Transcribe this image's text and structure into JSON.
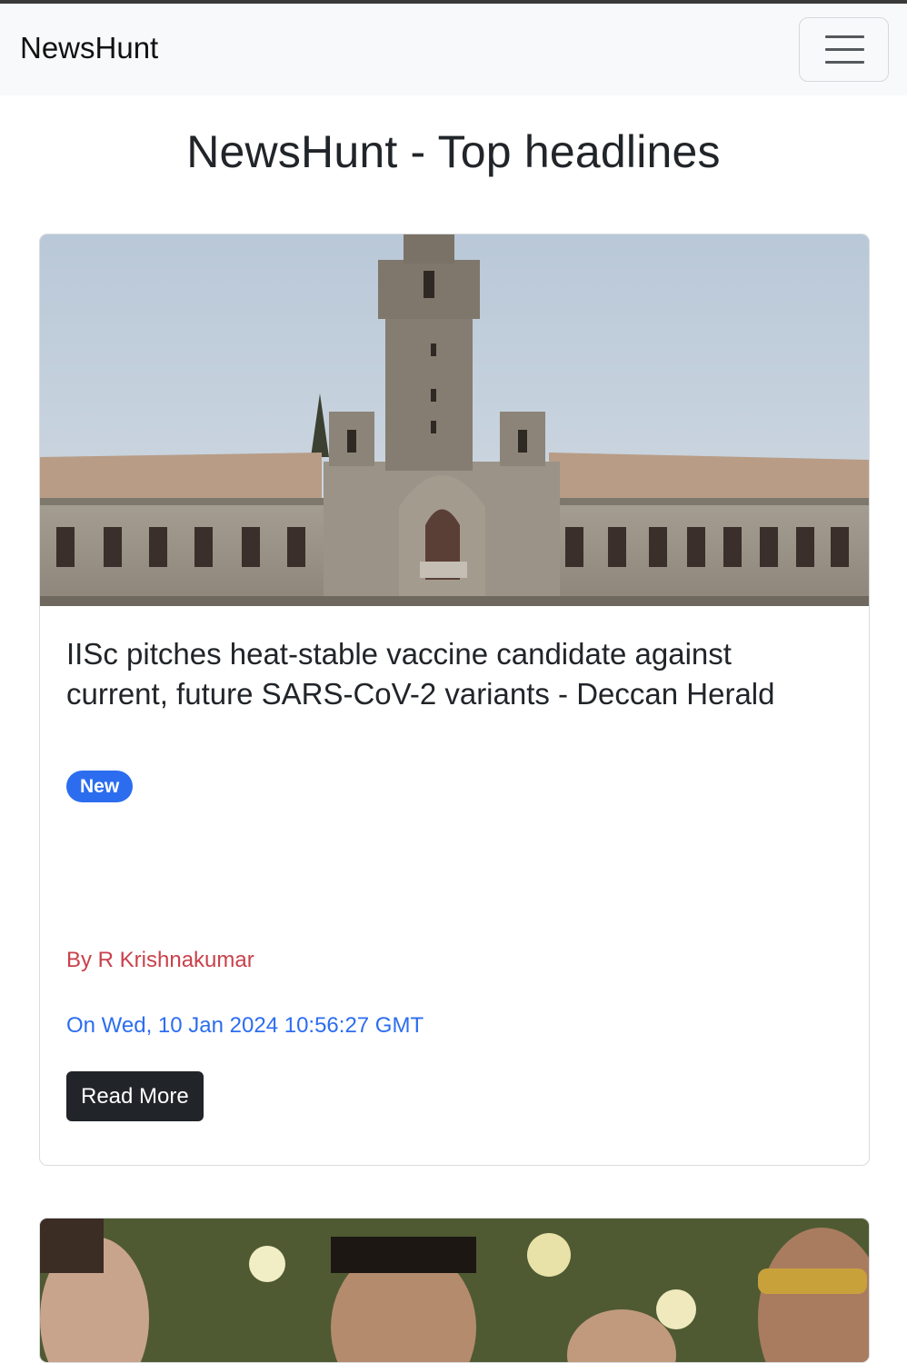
{
  "navbar": {
    "brand": "NewsHunt",
    "toggler_icon": "hamburger-menu-icon"
  },
  "page": {
    "title": "NewsHunt - Top headlines"
  },
  "articles": [
    {
      "image_alt": "IISc main building tower",
      "title": "IISc pitches heat-stable vaccine candidate against current, future SARS-CoV-2 variants - Deccan Herald",
      "badge": "New",
      "author": "By R Krishnakumar",
      "date": "On Wed, 10 Jan 2024 10:56:27 GMT",
      "button_label": "Read More"
    },
    {
      "image_alt": "People smiling in front of flowers"
    }
  ],
  "colors": {
    "navbar_bg": "#f8f9fa",
    "badge_bg": "#2c6df0",
    "author_text": "#c9414b",
    "date_text": "#2c6df0",
    "button_bg": "#212529"
  }
}
